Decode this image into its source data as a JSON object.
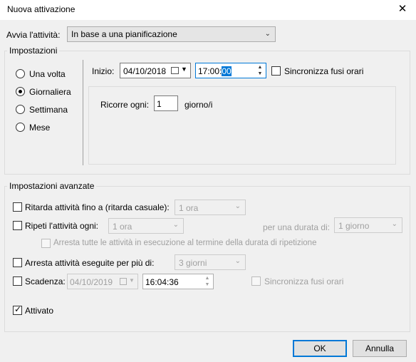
{
  "window": {
    "title": "Nuova attivazione",
    "close_glyph": "✕"
  },
  "trigger": {
    "label": "Avvia l'attività:",
    "value": "In base a una pianificazione"
  },
  "settings": {
    "legend": "Impostazioni",
    "radios": [
      {
        "label": "Una volta",
        "selected": false
      },
      {
        "label": "Giornaliera",
        "selected": true
      },
      {
        "label": "Settimana",
        "selected": false
      },
      {
        "label": "Mese",
        "selected": false
      }
    ],
    "start_label": "Inizio:",
    "start_date": "04/10/2018",
    "start_time_prefix": "17:00:",
    "start_time_selected": "00",
    "sync_tz_label": "Sincronizza fusi orari",
    "recur_label": "Ricorre ogni:",
    "recur_value": "1",
    "recur_unit": "giorno/i"
  },
  "advanced": {
    "legend": "Impostazioni avanzate",
    "delay_label": "Ritarda attività fino a (ritarda casuale):",
    "delay_value": "1 ora",
    "repeat_label": "Ripeti l'attività ogni:",
    "repeat_value": "1 ora",
    "duration_label": "per una durata di:",
    "duration_value": "1 giorno",
    "stop_all_label": "Arresta tutte le attività in esecuzione al termine della durata di ripetizione",
    "stop_longer_label": "Arresta attività eseguite per più di:",
    "stop_longer_value": "3 giorni",
    "expire_label": "Scadenza:",
    "expire_date": "04/10/2019",
    "expire_time": "16:04:36",
    "expire_sync_label": "Sincronizza fusi orari",
    "enabled_label": "Attivato",
    "enabled_checked": true
  },
  "buttons": {
    "ok": "OK",
    "cancel": "Annulla"
  },
  "colors": {
    "accent": "#0078d7",
    "background": "#f0f0f0"
  }
}
